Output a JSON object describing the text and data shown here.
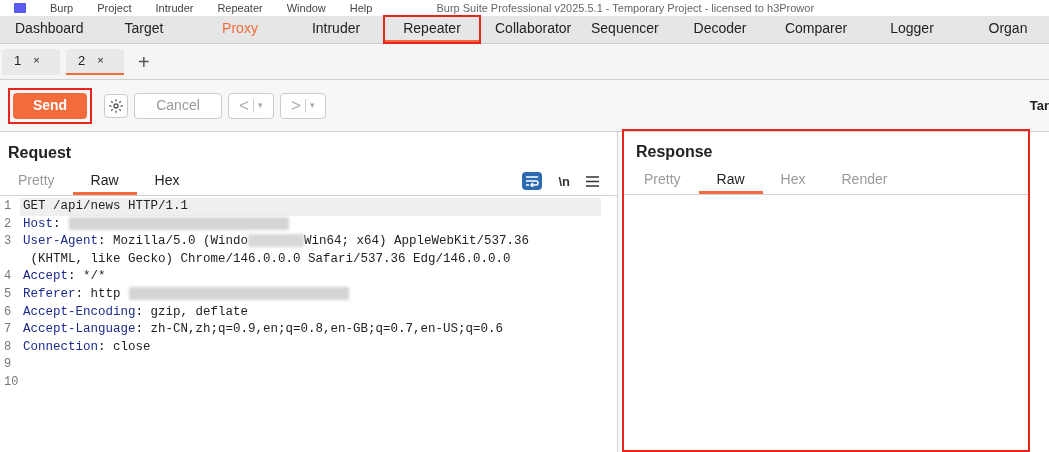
{
  "menu_bar": {
    "items": [
      "Burp",
      "Project",
      "Intruder",
      "Repeater",
      "Window",
      "Help"
    ],
    "title": "Burp Suite Professional v2025.5.1 - Temporary Project - licensed to h3Prowor"
  },
  "main_tabs": [
    {
      "label": "Dashboard",
      "selected": false,
      "highlighted": false,
      "alert": false
    },
    {
      "label": "Target",
      "selected": false,
      "highlighted": false,
      "alert": false
    },
    {
      "label": "Proxy",
      "selected": false,
      "highlighted": false,
      "alert": true
    },
    {
      "label": "Intruder",
      "selected": false,
      "highlighted": false,
      "alert": false
    },
    {
      "label": "Repeater",
      "selected": true,
      "highlighted": true,
      "alert": false
    },
    {
      "label": "Collaborator",
      "selected": false,
      "highlighted": false,
      "alert": false
    },
    {
      "label": "Sequencer",
      "selected": false,
      "highlighted": false,
      "alert": false
    },
    {
      "label": "Decoder",
      "selected": false,
      "highlighted": false,
      "alert": false
    },
    {
      "label": "Comparer",
      "selected": false,
      "highlighted": false,
      "alert": false
    },
    {
      "label": "Logger",
      "selected": false,
      "highlighted": false,
      "alert": false
    },
    {
      "label": "Organ",
      "selected": false,
      "highlighted": false,
      "alert": false
    }
  ],
  "request_tabs": [
    {
      "label": "1",
      "close": "×",
      "selected": false
    },
    {
      "label": "2",
      "close": "×",
      "selected": true
    }
  ],
  "new_tab": "+",
  "toolbar": {
    "send": {
      "label": "Send",
      "highlighted": true
    },
    "cancel": {
      "label": "Cancel",
      "disabled": true
    },
    "back": {
      "label": "<",
      "dropdown": "▾",
      "disabled": true
    },
    "forward": {
      "label": ">",
      "dropdown": "▾",
      "disabled": true
    },
    "target_label": "Tar"
  },
  "request": {
    "title": "Request",
    "view_tabs": [
      {
        "label": "Pretty",
        "selected": false,
        "disabled": true
      },
      {
        "label": "Raw",
        "selected": true,
        "disabled": false
      },
      {
        "label": "Hex",
        "selected": false,
        "disabled": false
      }
    ],
    "wrap_on": true,
    "newline_toggle": "\\n",
    "lines": [
      {
        "number": "1",
        "current": true,
        "segments": [
          {
            "kind": "text",
            "text": "GET /api/news HTTP/1.1"
          }
        ]
      },
      {
        "number": "2",
        "current": false,
        "segments": [
          {
            "kind": "key",
            "text": "Host"
          },
          {
            "kind": "text",
            "text": ":"
          },
          {
            "kind": "blur_long"
          }
        ]
      },
      {
        "number": "3",
        "current": false,
        "segments": [
          {
            "kind": "key",
            "text": "User-Agent"
          },
          {
            "kind": "text",
            "text": ": Mozilla/5.0 (Windo"
          },
          {
            "kind": "blur_short"
          },
          {
            "kind": "text",
            "text": "Win64; x64) AppleWebKit/537.36"
          }
        ]
      },
      {
        "current": false,
        "segments": [
          {
            "kind": "text",
            "text": " (KHTML, like Gecko) Chrome/146.0.0.0 Safari/537.36 Edg/146.0.0.0"
          }
        ]
      },
      {
        "number": "4",
        "current": false,
        "segments": [
          {
            "kind": "key",
            "text": "Accept"
          },
          {
            "kind": "text",
            "text": ": */*"
          }
        ]
      },
      {
        "number": "5",
        "current": false,
        "segments": [
          {
            "kind": "key",
            "text": "Referer"
          },
          {
            "kind": "text",
            "text": ": http"
          },
          {
            "kind": "blur_long"
          }
        ]
      },
      {
        "number": "6",
        "current": false,
        "segments": [
          {
            "kind": "key",
            "text": "Accept-Encoding"
          },
          {
            "kind": "text",
            "text": ": gzip, deflate"
          }
        ]
      },
      {
        "number": "7",
        "current": false,
        "segments": [
          {
            "kind": "key",
            "text": "Accept-Language"
          },
          {
            "kind": "text",
            "text": ": zh-CN,zh;q=0.9,en;q=0.8,en-GB;q=0.7,en-US;q=0.6"
          }
        ]
      },
      {
        "number": "8",
        "current": false,
        "segments": [
          {
            "kind": "key",
            "text": "Connection"
          },
          {
            "kind": "text",
            "text": ": close"
          }
        ]
      },
      {
        "number": "9",
        "current": false
      },
      {
        "number": "10",
        "current": false
      }
    ]
  },
  "response": {
    "title": "Response",
    "highlighted": true,
    "view_tabs": [
      {
        "label": "Pretty",
        "selected": false,
        "disabled": true
      },
      {
        "label": "Raw",
        "selected": true,
        "disabled": false
      },
      {
        "label": "Hex",
        "selected": false,
        "disabled": true
      },
      {
        "label": "Render",
        "selected": false,
        "disabled": true
      }
    ]
  }
}
